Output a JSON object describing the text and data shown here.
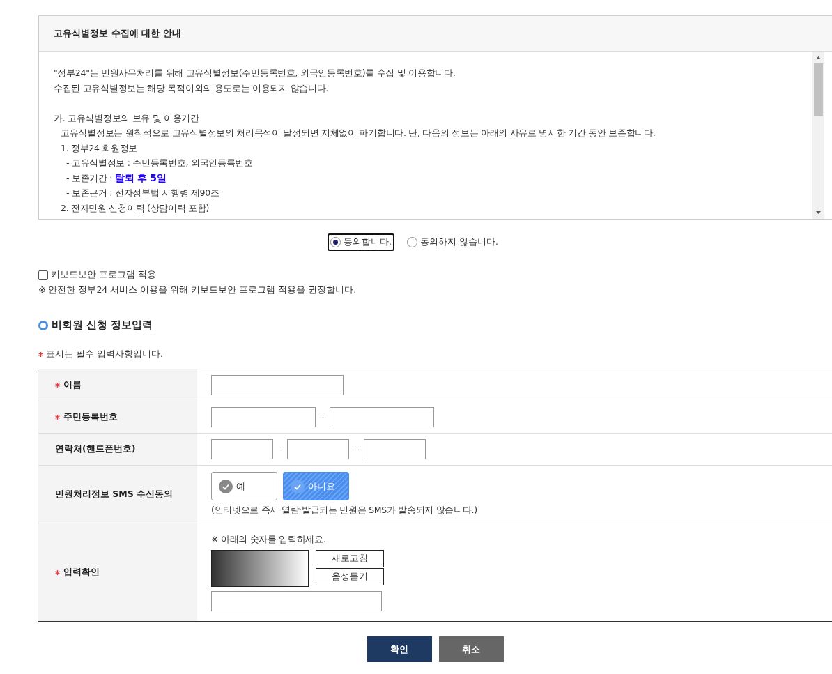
{
  "notice": {
    "title": "고유식별정보 수집에 대한 안내",
    "lines": [
      {
        "kind": "text",
        "text": "\"정부24\"는 민원사무처리를 위해 고유식별정보(주민등록번호, 외국인등록번호)를 수집 및 이용합니다."
      },
      {
        "kind": "text",
        "text": "수집된 고유식별정보는 해당 목적이외의 용도로는 이용되지 않습니다."
      },
      {
        "kind": "gap"
      },
      {
        "kind": "text",
        "text": "가. 고유식별정보의 보유 및 이용기간"
      },
      {
        "kind": "item",
        "text": "고유식별정보는 원칙적으로 고유식별정보의 처리목적이 달성되면 지체없이 파기합니다. 단, 다음의 정보는 아래의 사유로 명시한 기간 동안 보존합니다."
      },
      {
        "kind": "item",
        "text": "1. 정부24 회원정보"
      },
      {
        "kind": "detail",
        "text": "- 고유식별정보 : 주민등록번호, 외국인등록번호"
      },
      {
        "kind": "detail",
        "text": "- 보존기간 : **탈퇴 후 5일**"
      },
      {
        "kind": "detail",
        "text": "- 보존근거 : 전자정부법 시행령 제90조"
      },
      {
        "kind": "item",
        "text": "2. 전자민원 신청이력 (상담이력 포함)"
      }
    ]
  },
  "consent": [
    {
      "label": "동의합니다.",
      "selected": true
    },
    {
      "label": "동의하지 않습니다.",
      "selected": false
    }
  ],
  "keyboard_security": {
    "label": "키보드보안 프로그램 적용",
    "checked": false,
    "note": "※ 안전한 정부24 서비스 이용을 위해 키보드보안 프로그램 적용을 권장합니다."
  },
  "section_title": "비회원 신청 정보입력",
  "required_note": "표시는 필수 입력사항입니다.",
  "form": [
    {
      "kind": "input",
      "label": "이름",
      "required": true
    },
    {
      "kind": "split",
      "label": "주민등록번호",
      "required": true,
      "separators": [
        "-"
      ]
    },
    {
      "kind": "split",
      "label": "연락처(핸드폰번호)",
      "required": false,
      "separators": [
        "-",
        "-"
      ]
    },
    {
      "kind": "choice",
      "label": "민원처리정보 SMS 수신동의",
      "required": false,
      "options": [
        {
          "label": "예",
          "selected": false
        },
        {
          "label": "아니요",
          "selected": true
        }
      ],
      "note": "(인터넷으로 즉시 열람·발급되는 민원은 SMS가 발송되지 않습니다.)"
    },
    {
      "kind": "captcha",
      "label": "입력확인",
      "required": true,
      "hint": "※ 아래의 숫자를 입력하세요.",
      "buttons": [
        "새로고침",
        "음성듣기"
      ]
    }
  ],
  "buttons": [
    {
      "label": "확인",
      "kind": "primary"
    },
    {
      "label": "취소",
      "kind": "secondary"
    }
  ]
}
